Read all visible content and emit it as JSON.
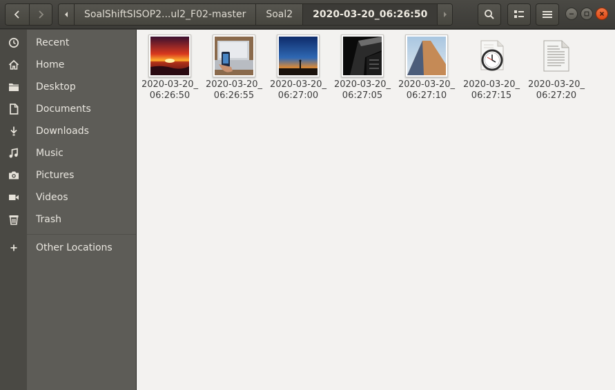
{
  "pathbar": {
    "segments": [
      {
        "label": "SoalShiftSISOP2...ul2_F02-master",
        "current": false
      },
      {
        "label": "Soal2",
        "current": false
      },
      {
        "label": "2020-03-20_06:26:50",
        "current": true
      }
    ]
  },
  "sidebar": {
    "items": [
      {
        "label": "Recent",
        "icon": "clock-icon"
      },
      {
        "label": "Home",
        "icon": "home-icon"
      },
      {
        "label": "Desktop",
        "icon": "folder-icon"
      },
      {
        "label": "Documents",
        "icon": "document-icon"
      },
      {
        "label": "Downloads",
        "icon": "download-icon"
      },
      {
        "label": "Music",
        "icon": "music-icon"
      },
      {
        "label": "Pictures",
        "icon": "camera-icon"
      },
      {
        "label": "Videos",
        "icon": "video-icon"
      },
      {
        "label": "Trash",
        "icon": "trash-icon"
      }
    ],
    "other_locations": {
      "label": "Other Locations",
      "icon": "plus-icon"
    }
  },
  "files": [
    {
      "line1": "2020-03-20_",
      "line2": "06:26:50",
      "kind": "image",
      "thumb": "sunset-sea"
    },
    {
      "line1": "2020-03-20_",
      "line2": "06:26:55",
      "kind": "image",
      "thumb": "laptop-phone"
    },
    {
      "line1": "2020-03-20_",
      "line2": "06:27:00",
      "kind": "image",
      "thumb": "dusk-silhouette"
    },
    {
      "line1": "2020-03-20_",
      "line2": "06:27:05",
      "kind": "image",
      "thumb": "dark-building"
    },
    {
      "line1": "2020-03-20_",
      "line2": "06:27:10",
      "kind": "image",
      "thumb": "sand-dune"
    },
    {
      "line1": "2020-03-20_",
      "line2": "06:27:15",
      "kind": "pending",
      "thumb": "clock-document"
    },
    {
      "line1": "2020-03-20_",
      "line2": "06:27:20",
      "kind": "text",
      "thumb": "text-document"
    }
  ],
  "colors": {
    "header": "#3c3b37",
    "sidebar": "#5d5c57",
    "sidebar_rail": "#4a4944",
    "content": "#f3f2f0",
    "close_button": "#dd4814"
  }
}
